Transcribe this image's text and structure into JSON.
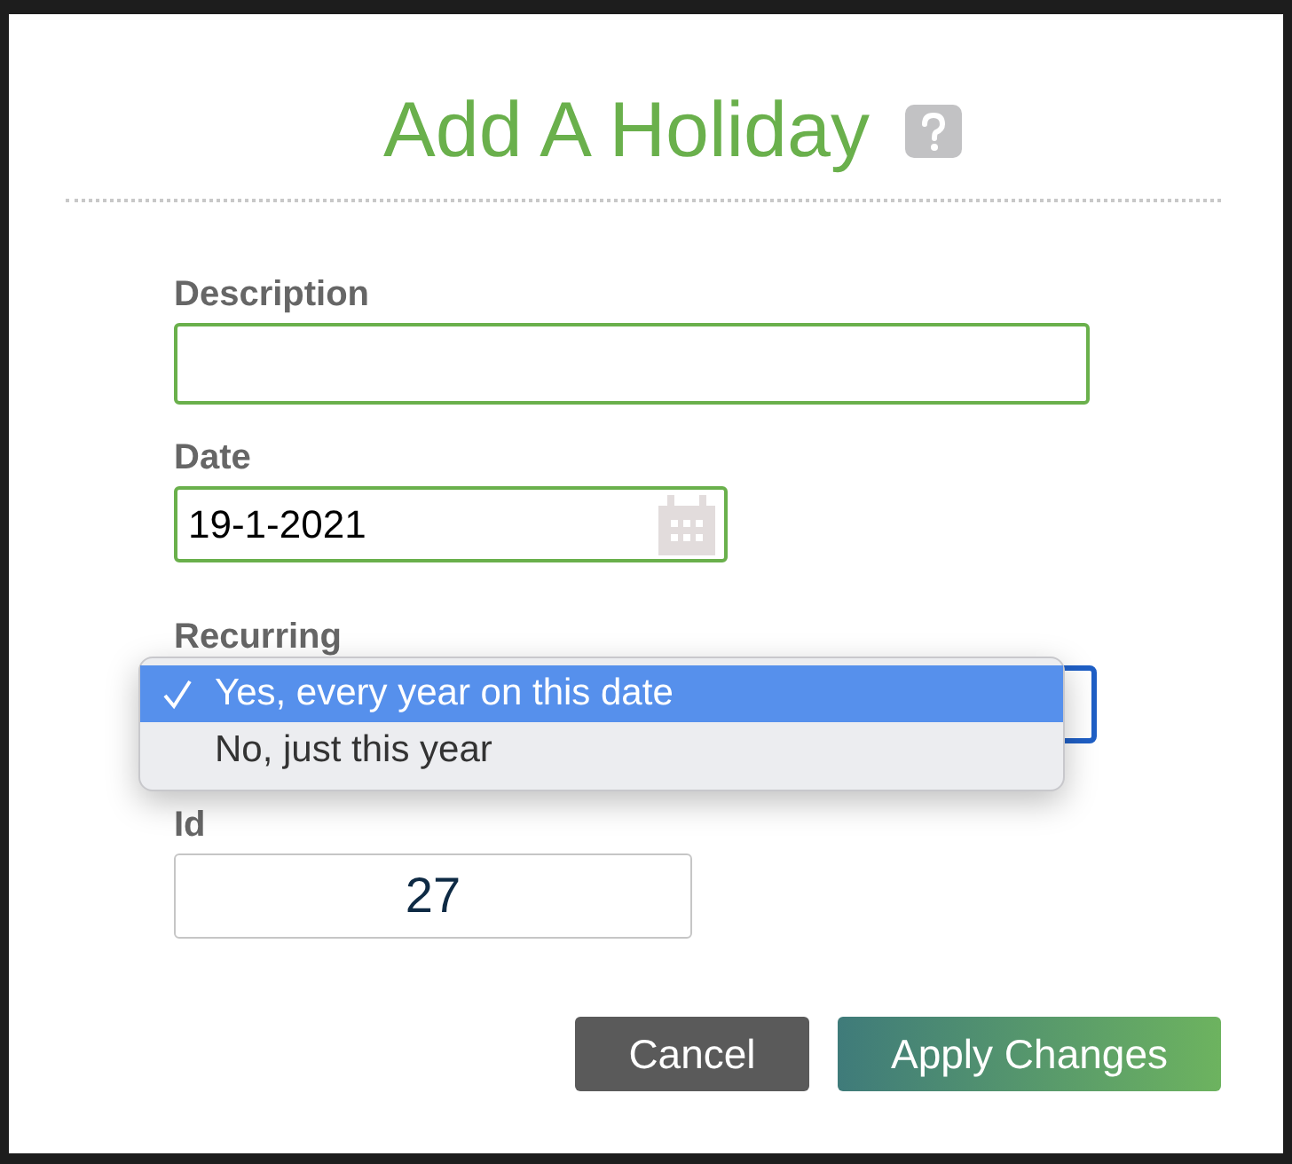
{
  "dialog": {
    "title": "Add A Holiday",
    "fields": [
      {
        "kind": "text",
        "label": "Description"
      },
      {
        "kind": "date",
        "label": "Date",
        "value": "19-1-2021"
      },
      {
        "kind": "select",
        "label": "Recurring",
        "options": [
          {
            "label": "Yes, every year on this date",
            "selected": true
          },
          {
            "label": "No, just this year",
            "selected": false
          }
        ]
      },
      {
        "kind": "number",
        "label": "Id",
        "value": "27"
      }
    ],
    "buttons": [
      {
        "kind": "secondary",
        "label": "Cancel"
      },
      {
        "kind": "primary",
        "label": "Apply Changes"
      }
    ]
  }
}
